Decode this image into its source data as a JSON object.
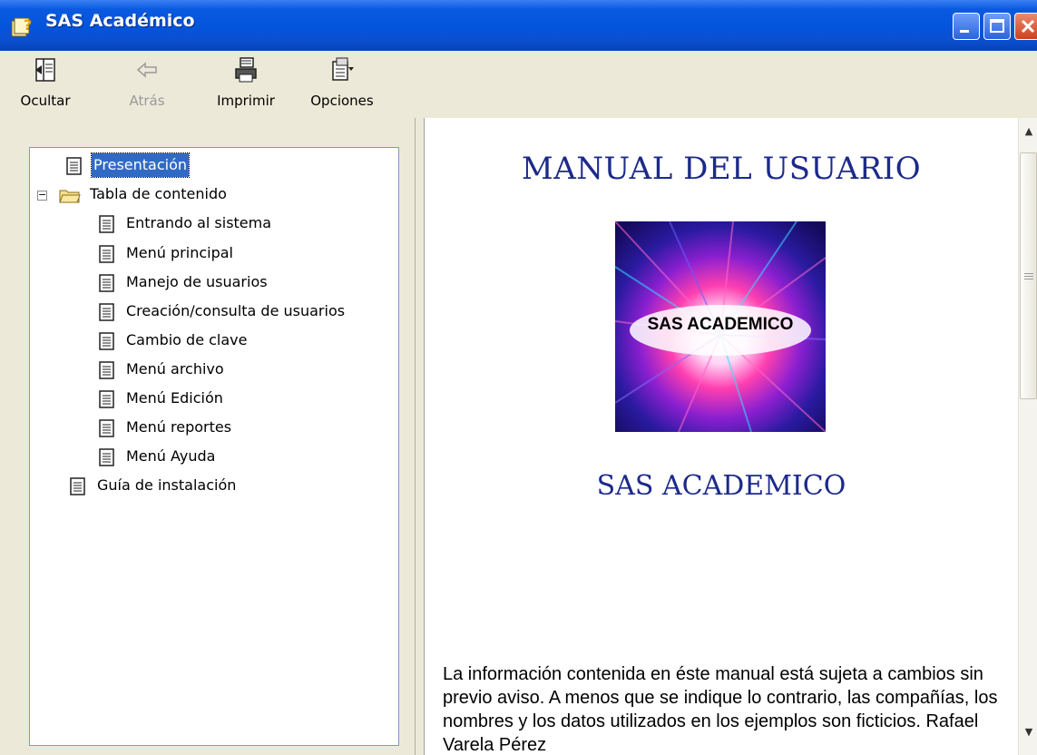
{
  "window": {
    "title": "SAS Académico"
  },
  "toolbar": {
    "hide_label": "Ocultar",
    "back_label": "Atrás",
    "print_label": "Imprimir",
    "options_label": "Opciones"
  },
  "tree": {
    "presentation": "Presentación",
    "toc": "Tabla de contenido",
    "items": [
      "Entrando al sistema",
      "Menú principal",
      "Manejo de usuarios",
      "Creación/consulta de usuarios",
      "Cambio de clave",
      "Menú archivo",
      "Menú Edición",
      "Menú reportes",
      "Menú Ayuda"
    ],
    "install_guide": "Guía de instalación"
  },
  "content": {
    "heading": "MANUAL DEL USUARIO",
    "cover_text": "SAS ACADEMICO",
    "subheading": "SAS ACADEMICO",
    "paragraph": "La información contenida en éste manual está sujeta a cambios sin previo aviso. A menos que se indique lo contrario, las compañías, los nombres y los datos utilizados en los ejemplos son ficticios. Rafael Varela Pérez"
  },
  "colors": {
    "title_bar": "#0454dc",
    "heading_text": "#1c2a8a",
    "selection": "#316ac5"
  }
}
